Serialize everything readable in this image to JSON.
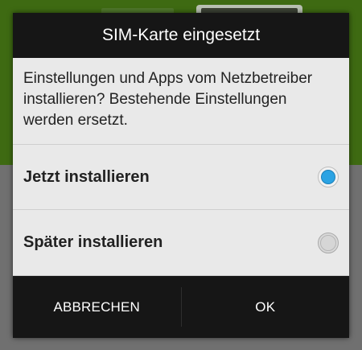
{
  "dialog": {
    "title": "SIM-Karte eingesetzt",
    "message": "Einstellungen und Apps vom Netzbetreiber installieren? Bestehende Einstellungen werden ersetzt.",
    "options": [
      {
        "label": "Jetzt installieren",
        "selected": true
      },
      {
        "label": "Später installieren",
        "selected": false
      }
    ],
    "buttons": {
      "cancel_label": "ABBRECHEN",
      "ok_label": "OK"
    }
  },
  "colors": {
    "accent": "#2ba3e3",
    "header_bg": "#161616",
    "dialog_bg": "#e9e9e9",
    "background_top": "#3e6a12",
    "background_bottom": "#707070"
  }
}
